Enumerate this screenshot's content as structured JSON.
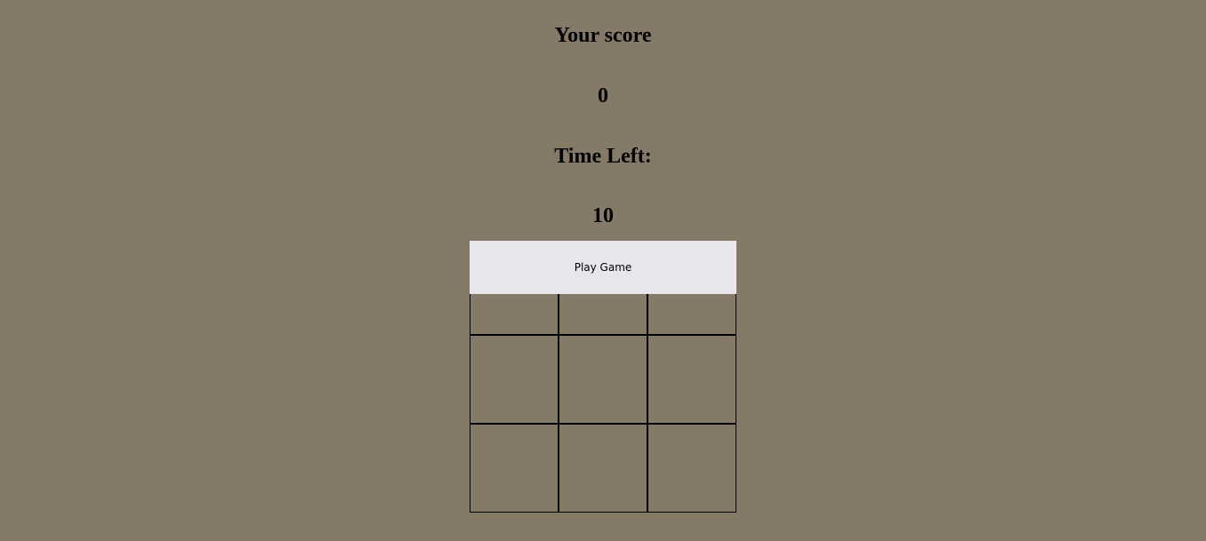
{
  "score": {
    "title": "Your score",
    "value": "0"
  },
  "timer": {
    "title": "Time Left:",
    "value": "10"
  },
  "controls": {
    "play_label": "Play Game"
  },
  "board": {
    "rows": 3,
    "cols": 3
  },
  "colors": {
    "background": "#857967",
    "button": "#e8e6eb",
    "grid_line": "#000000"
  }
}
